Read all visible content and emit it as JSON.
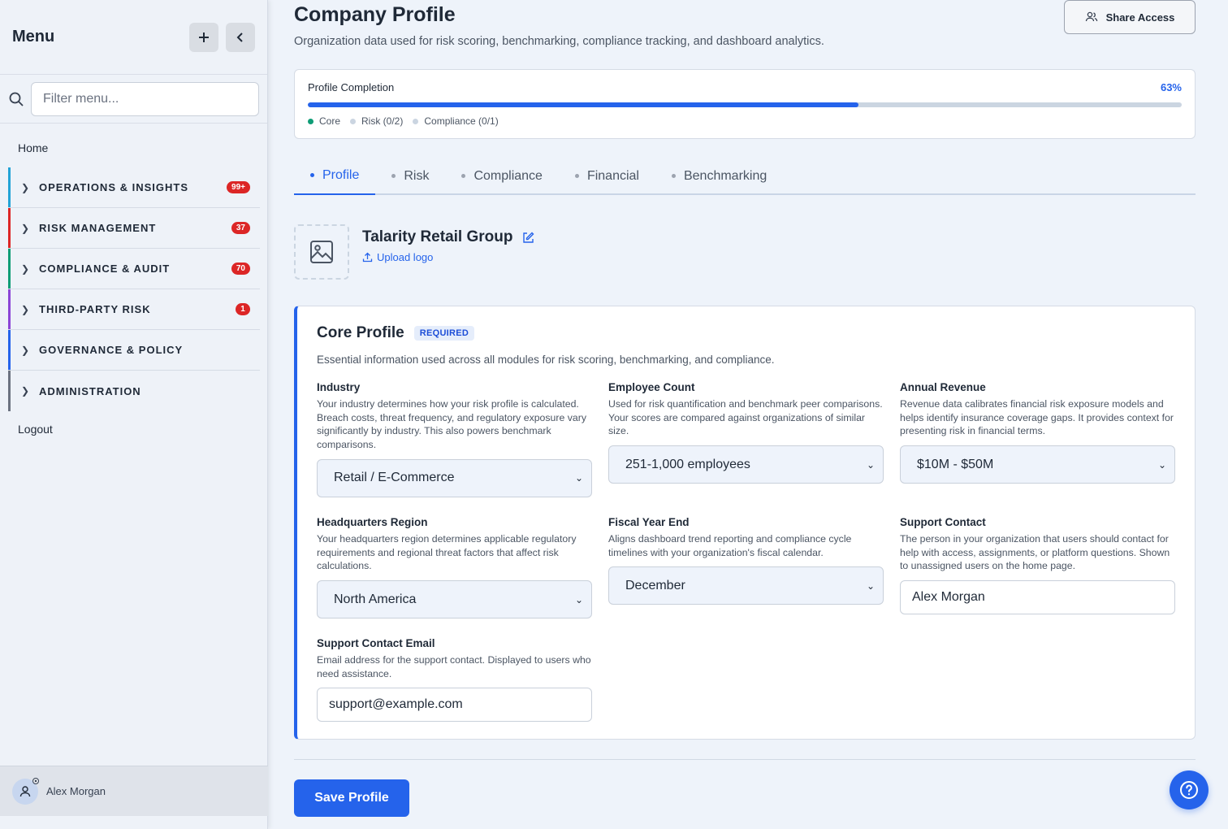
{
  "sidebar": {
    "title": "Menu",
    "filter_placeholder": "Filter menu...",
    "home": "Home",
    "items": [
      {
        "label": "OPERATIONS & INSIGHTS",
        "badge": "99+",
        "color": "#22a3d6"
      },
      {
        "label": "RISK MANAGEMENT",
        "badge": "37",
        "color": "#dc2626"
      },
      {
        "label": "COMPLIANCE & AUDIT",
        "badge": "70",
        "color": "#0f9d76"
      },
      {
        "label": "THIRD-PARTY RISK",
        "badge": "1",
        "color": "#8b45d6"
      },
      {
        "label": "GOVERNANCE & POLICY",
        "badge": "",
        "color": "#2563eb"
      },
      {
        "label": "ADMINISTRATION",
        "badge": "",
        "color": "#6b7280"
      }
    ],
    "logout": "Logout",
    "user_name": "Alex Morgan"
  },
  "header": {
    "title": "Company Profile",
    "subtitle": "Organization data used for risk scoring, benchmarking, compliance tracking, and dashboard analytics.",
    "share_label": "Share Access"
  },
  "progress": {
    "label": "Profile Completion",
    "percent_text": "63%",
    "percent": 63,
    "legend": [
      {
        "label": "Core",
        "color": "#0f9d76"
      },
      {
        "label": "Risk (0/2)",
        "color": "#cbd5e1"
      },
      {
        "label": "Compliance (0/1)",
        "color": "#cbd5e1"
      }
    ]
  },
  "tabs": [
    "Profile",
    "Risk",
    "Compliance",
    "Financial",
    "Benchmarking"
  ],
  "org": {
    "name": "Talarity Retail Group",
    "upload_label": "Upload logo"
  },
  "core": {
    "title": "Core Profile",
    "badge": "REQUIRED",
    "description": "Essential information used across all modules for risk scoring, benchmarking, and compliance.",
    "fields": {
      "industry": {
        "label": "Industry",
        "help": "Your industry determines how your risk profile is calculated. Breach costs, threat frequency, and regulatory exposure vary significantly by industry. This also powers benchmark comparisons.",
        "value": "Retail / E-Commerce"
      },
      "employees": {
        "label": "Employee Count",
        "help": "Used for risk quantification and benchmark peer comparisons. Your scores are compared against organizations of similar size.",
        "value": "251-1,000 employees"
      },
      "revenue": {
        "label": "Annual Revenue",
        "help": "Revenue data calibrates financial risk exposure models and helps identify insurance coverage gaps. It provides context for presenting risk in financial terms.",
        "value": "$10M - $50M"
      },
      "region": {
        "label": "Headquarters Region",
        "help": "Your headquarters region determines applicable regulatory requirements and regional threat factors that affect risk calculations.",
        "value": "North America"
      },
      "fiscal": {
        "label": "Fiscal Year End",
        "help": "Aligns dashboard trend reporting and compliance cycle timelines with your organization's fiscal calendar.",
        "value": "December"
      },
      "contact": {
        "label": "Support Contact",
        "help": "The person in your organization that users should contact for help with access, assignments, or platform questions. Shown to unassigned users on the home page.",
        "value": "Alex Morgan"
      },
      "email": {
        "label": "Support Contact Email",
        "help": "Email address for the support contact. Displayed to users who need assistance.",
        "value": "support@example.com"
      }
    }
  },
  "save_label": "Save Profile"
}
